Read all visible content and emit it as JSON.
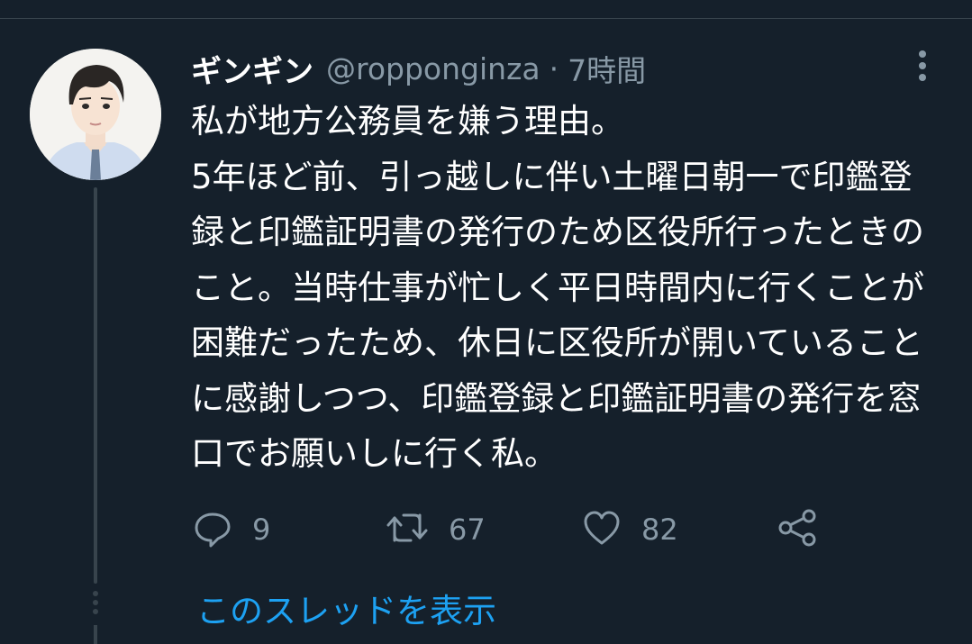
{
  "tweet": {
    "display_name": "ギンギン",
    "handle": "@ropponginza",
    "separator": "·",
    "time": "7時間",
    "text": "私が地方公務員を嫌う理由。\n5年ほど前、引っ越しに伴い土曜日朝一で印鑑登録と印鑑証明書の発行のため区役所行ったときのこと。当時仕事が忙しく平日時間内に行くことが困難だったため、休日に区役所が開いていることに感謝しつつ、印鑑登録と印鑑証明書の発行を窓口でお願いしに行く私。"
  },
  "actions": {
    "reply_count": "9",
    "retweet_count": "67",
    "like_count": "82"
  },
  "thread": {
    "show_thread_label": "このスレッドを表示"
  },
  "icons": {
    "more": "more-vertical-icon",
    "reply": "reply-icon",
    "retweet": "retweet-icon",
    "like": "heart-icon",
    "share": "share-icon"
  },
  "colors": {
    "background": "#15202b",
    "text_primary": "#ffffff",
    "text_secondary": "#8899a6",
    "link": "#1da1f2",
    "divider": "#38444d"
  }
}
